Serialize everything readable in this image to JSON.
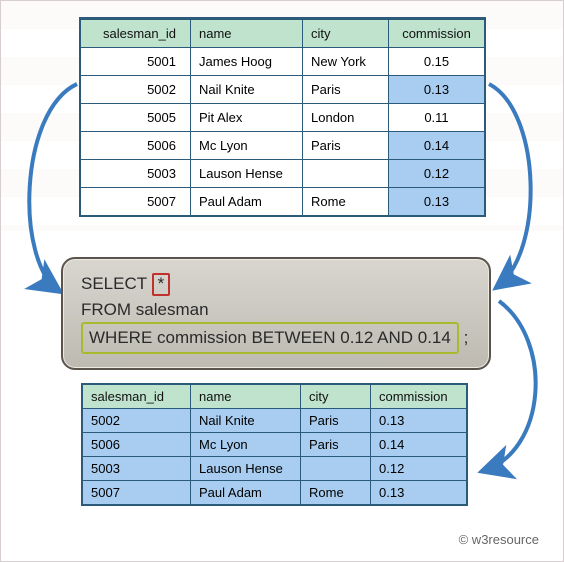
{
  "source_table": {
    "headers": [
      "salesman_id",
      "name",
      "city",
      "commission"
    ],
    "rows": [
      {
        "cells": [
          "5001",
          "James Hoog",
          "New York",
          "0.15"
        ],
        "commission_match": false
      },
      {
        "cells": [
          "5002",
          "Nail Knite",
          "Paris",
          "0.13"
        ],
        "commission_match": true
      },
      {
        "cells": [
          "5005",
          "Pit Alex",
          "London",
          "0.11"
        ],
        "commission_match": false
      },
      {
        "cells": [
          "5006",
          "Mc Lyon",
          "Paris",
          "0.14"
        ],
        "commission_match": true
      },
      {
        "cells": [
          "5003",
          "Lauson Hense",
          "",
          "0.12"
        ],
        "commission_match": true
      },
      {
        "cells": [
          "5007",
          "Paul Adam",
          "Rome",
          "0.13"
        ],
        "commission_match": true
      }
    ]
  },
  "sql": {
    "select_kw": "SELECT",
    "star": "*",
    "from_line": "FROM salesman",
    "where_line": "WHERE commission BETWEEN 0.12 AND 0.14",
    "terminator": ";"
  },
  "result_table": {
    "headers": [
      "salesman_id",
      "name",
      "city",
      "commission"
    ],
    "rows": [
      [
        "5002",
        "Nail Knite",
        "Paris",
        "0.13"
      ],
      [
        "5006",
        "Mc Lyon",
        "Paris",
        "0.14"
      ],
      [
        "5003",
        "Lauson Hense",
        "",
        "0.12"
      ],
      [
        "5007",
        "Paul Adam",
        "Rome",
        "0.13"
      ]
    ]
  },
  "attribution": "© w3resource",
  "colors": {
    "header_fill": "#bfe3cc",
    "highlight_fill": "#a8cdf0",
    "arrow": "#3a7bbf",
    "star_outline": "#c12f2f",
    "where_outline": "#a8ba2e"
  }
}
